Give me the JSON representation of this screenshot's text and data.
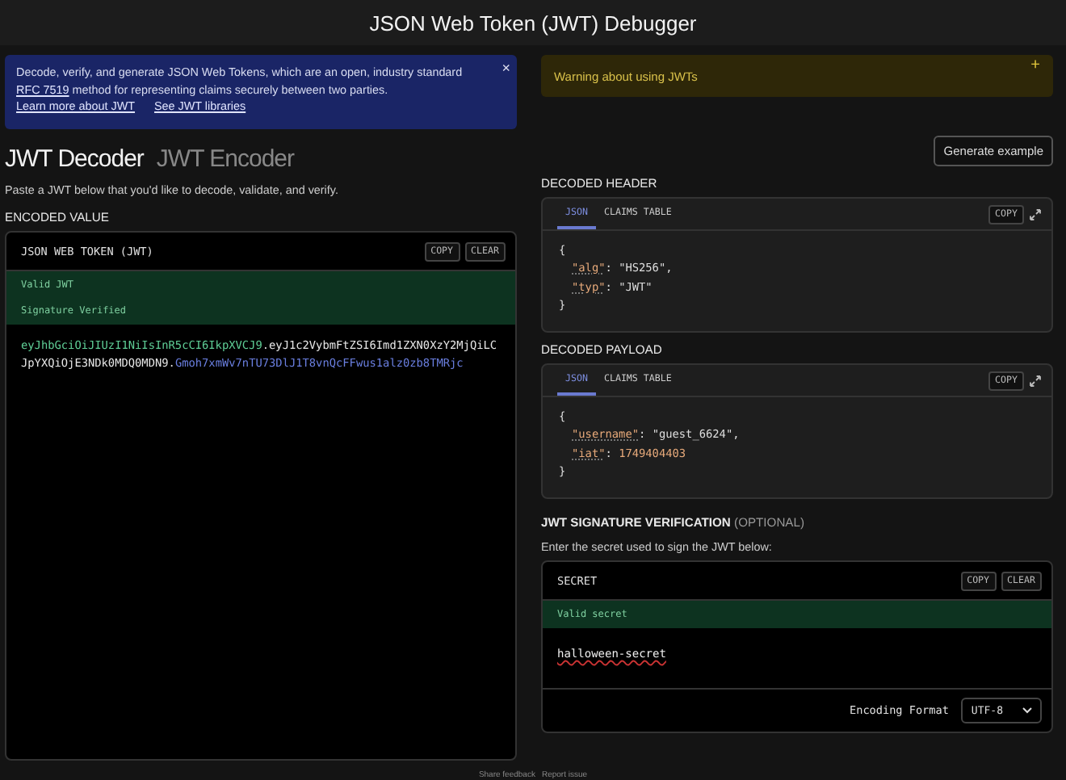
{
  "title": "JSON Web Token (JWT) Debugger",
  "info_banner": {
    "text_before": "Decode, verify, and generate JSON Web Tokens, which are an open, industry standard",
    "link": "RFC 7519",
    "text_after": "method for representing claims securely between two parties.",
    "links": [
      "Learn more about JWT",
      "See JWT libraries"
    ],
    "close": "×"
  },
  "warning_banner": {
    "text": "Warning about using JWTs",
    "toggle": "+"
  },
  "mode_tabs": [
    {
      "label": "JWT Decoder",
      "selected": true
    },
    {
      "label": "JWT Encoder",
      "selected": false
    }
  ],
  "instructions": "Paste a JWT below that you'd like to decode, validate, and verify.",
  "generate_button": "Generate example",
  "encoded": {
    "heading": "ENCODED VALUE",
    "panel_title": "JSON WEB TOKEN (JWT)",
    "copy": "COPY",
    "clear": "CLEAR",
    "statuses": [
      "Valid JWT",
      "Signature Verified"
    ],
    "token_parts": [
      {
        "kind": "header",
        "text": "eyJhbGciOiJIUzI1NiIsInR5cCI6IkpXVCJ9"
      },
      {
        "kind": "dot",
        "text": "."
      },
      {
        "kind": "payload",
        "text": "eyJ1c2VybmFtZSI6Imd1ZXN0XzY2MjQiLCJpYXQiOjE3NDk0MDQ0MDN9"
      },
      {
        "kind": "dot",
        "text": "."
      },
      {
        "kind": "signature",
        "text": "Gmoh7xmWv7nTU73DlJ1T8vnQcFFwus1alz0zb8TMRjc"
      }
    ]
  },
  "decoded_header": {
    "heading": "DECODED HEADER",
    "tabs": [
      {
        "label": "JSON",
        "selected": true
      },
      {
        "label": "CLAIMS TABLE",
        "selected": false
      }
    ],
    "copy": "COPY",
    "open": "{",
    "close": "}",
    "fields": [
      {
        "key": "\"alg\"",
        "colon": ":",
        "value": "\"HS256\"",
        "kind": "string",
        "comma": ","
      },
      {
        "key": "\"typ\"",
        "colon": ":",
        "value": "\"JWT\"",
        "kind": "string"
      }
    ]
  },
  "decoded_payload": {
    "heading": "DECODED PAYLOAD",
    "tabs": [
      {
        "label": "JSON",
        "selected": true
      },
      {
        "label": "CLAIMS TABLE",
        "selected": false
      }
    ],
    "copy": "COPY",
    "open": "{",
    "close": "}",
    "fields": [
      {
        "key": "\"username\"",
        "colon": ":",
        "value": "\"guest_6624\"",
        "kind": "string",
        "comma": ","
      },
      {
        "key": "\"iat\"",
        "colon": ":",
        "value": "1749404403",
        "kind": "number"
      }
    ]
  },
  "signature": {
    "heading": "JWT SIGNATURE VERIFICATION",
    "optional": "(OPTIONAL)",
    "prompt": "Enter the secret used to sign the JWT below:",
    "panel_title": "SECRET",
    "copy": "COPY",
    "clear": "CLEAR",
    "status": "Valid secret",
    "secret": "halloween-secret",
    "encoding_label": "Encoding Format",
    "encoding_value": "UTF-8"
  },
  "footer_links": [
    "Share feedback",
    "Report issue"
  ]
}
